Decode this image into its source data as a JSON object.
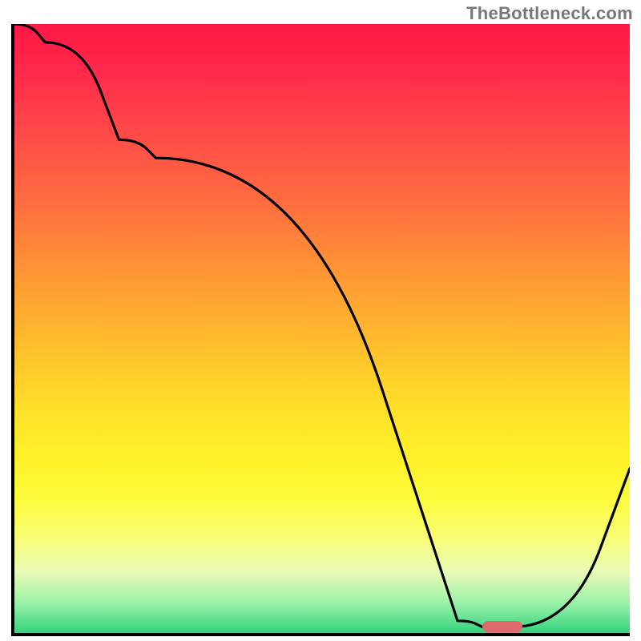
{
  "watermark": "TheBottleneck.com",
  "chart_data": {
    "type": "line",
    "title": "",
    "xlabel": "",
    "ylabel": "",
    "xlim": [
      0,
      100
    ],
    "ylim": [
      0,
      100
    ],
    "x": [
      0,
      5,
      17,
      23,
      72,
      76,
      81,
      100
    ],
    "values": [
      100,
      97,
      81,
      78,
      2,
      1,
      1,
      27
    ],
    "marker": {
      "x_range": [
        76,
        82.5
      ],
      "y": 1
    },
    "background_gradient": {
      "stops": [
        {
          "pos": 0,
          "color": "#ff1846"
        },
        {
          "pos": 8,
          "color": "#ff2a4a"
        },
        {
          "pos": 18,
          "color": "#ff4a48"
        },
        {
          "pos": 30,
          "color": "#ff6f3f"
        },
        {
          "pos": 42,
          "color": "#ff9a34"
        },
        {
          "pos": 54,
          "color": "#ffc22c"
        },
        {
          "pos": 64,
          "color": "#ffe228"
        },
        {
          "pos": 72,
          "color": "#fff22a"
        },
        {
          "pos": 78,
          "color": "#fdfc3d"
        },
        {
          "pos": 84,
          "color": "#f9fd71"
        },
        {
          "pos": 90,
          "color": "#e9fbb7"
        },
        {
          "pos": 95,
          "color": "#9bf2a8"
        },
        {
          "pos": 100,
          "color": "#34d37e"
        }
      ]
    },
    "marker_color": "#e06a6d",
    "line_color": "#000000"
  }
}
